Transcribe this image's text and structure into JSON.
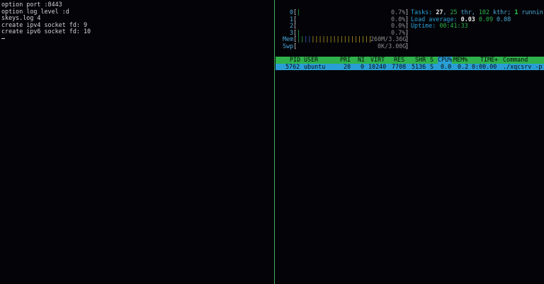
{
  "left_terminal": {
    "lines": [
      "option port :8443",
      "option log level :d",
      "skeys.log 4",
      "create ipv4 socket fd: 9",
      "create ipv6 socket fd: 10"
    ]
  },
  "htop": {
    "cpus": [
      {
        "label": "0",
        "pct": "0.7%",
        "bar": "|"
      },
      {
        "label": "1",
        "pct": "0.0%",
        "bar": ""
      },
      {
        "label": "2",
        "pct": "0.0%",
        "bar": ""
      },
      {
        "label": "3",
        "pct": "0.7%",
        "bar": "|"
      }
    ],
    "mem": {
      "label": "Mem",
      "bar_green": "||",
      "bar_blue": "||",
      "bar_yellow": "|||||||||||||||||",
      "value": "260M/3.36G"
    },
    "swp": {
      "label": "Swp",
      "value": "0K/3.00G"
    },
    "tasks": {
      "label": "Tasks:",
      "count": "27",
      "sep": ",",
      "thr": "25",
      "thr_label": "thr,",
      "kthr": "102",
      "kthr_label": "kthr;",
      "running": "1",
      "running_label": "runnin"
    },
    "load": {
      "label": "Load average:",
      "v1": "0.03",
      "v2": "0.09",
      "v3": "0.08"
    },
    "uptime": {
      "label": "Uptime:",
      "value": "00:41:33"
    },
    "columns": [
      "PID",
      "USER",
      "PRI",
      "NI",
      "VIRT",
      "RES",
      "SHR",
      "S",
      "CPU%",
      "MEM%",
      "TIME+",
      "Command"
    ],
    "process": {
      "pid": "5762",
      "user": "ubuntu",
      "pri": "20",
      "ni": "0",
      "virt": "10240",
      "res": "7708",
      "shr": "5136",
      "s": "S",
      "cpu": "0.0",
      "mem": "0.2",
      "time": "0:00.00",
      "command": "./xqcsrv -p"
    }
  }
}
